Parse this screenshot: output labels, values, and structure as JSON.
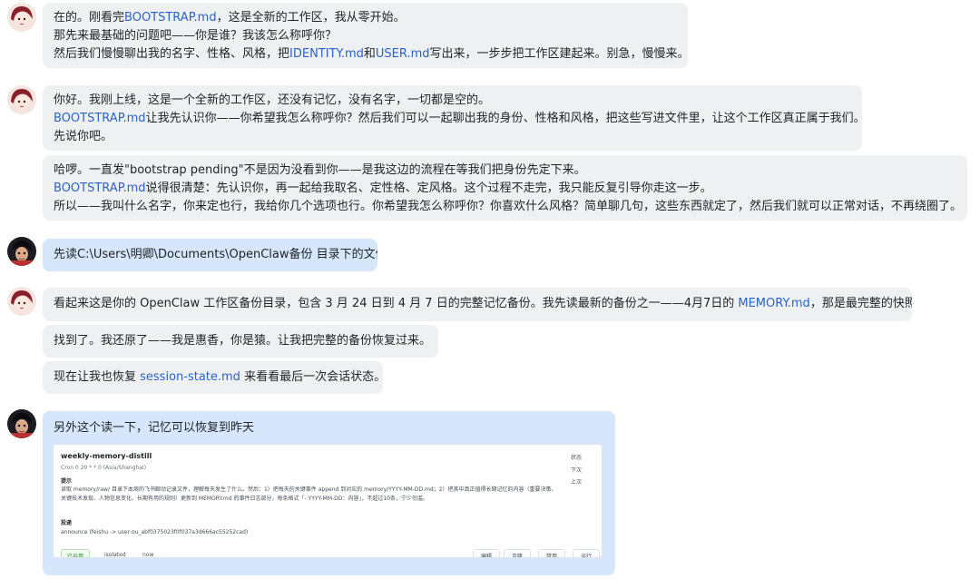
{
  "messages": [
    {
      "role": "user",
      "lines": [
        [
          "在的。刚看完",
          "BOOTSTRAP.md",
          "，这是全新的工作区，我从零开始。"
        ],
        [
          "那先来最基础的问题吧——你是谁？我该怎么称呼你？"
        ],
        [
          "然后我们慢慢聊出我的名字、性格、风格，把",
          "IDENTITY.md",
          "和",
          "USER.md",
          "写出来，一步步把工作区建起来。别急，慢慢来。"
        ]
      ]
    },
    {
      "role": "assistant",
      "lines": [
        [
          "你好。我刚上线，这是一个全新的工作区，还没有记忆，没有名字，一切都是空的。"
        ],
        [
          "BOOTSTRAP.md",
          "让我先认识你——你希望我怎么称呼你？然后我们可以一起聊出我的身份、性格和风格，把这些写进文件里，让这个工作区真正属于我们。"
        ],
        [
          "先说你吧。"
        ]
      ]
    },
    {
      "role": "assistant",
      "lines": [
        [
          "哈啰。一直发\"bootstrap pending\"不是因为没看到你——是我这边的流程在等我们把身份先定下来。"
        ],
        [
          "BOOTSTRAP.md",
          "说得很清楚：先认识你，再一起给我取名、定性格、定风格。这个过程不走完，我只能反复引导你走这一步。"
        ],
        [
          "所以——我叫什么名字，你来定也行，我给你几个选项也行。你希望我怎么称呼你？你喜欢什么风格？简单聊几句，这些东西就定了，然后我们就可以正常对话，不再绕圈了。"
        ]
      ]
    },
    {
      "role": "user",
      "lines": [
        [
          "先读C:\\Users\\明卿\\Documents\\OpenClaw备份 目录下的文件"
        ]
      ]
    },
    {
      "role": "assistant",
      "lines": [
        [
          "看起来这是你的 OpenClaw 工作区备份目录，包含 3 月 24 日到 4 月 7 日的完整记忆备份。我先读最新的备份之一——4月7日的 ",
          "MEMORY.md",
          "，那是最完整的快照。"
        ]
      ]
    },
    {
      "role": "assistant",
      "lines": [
        [
          "找到了。我还原了——我是惠香，你是猿。让我把完整的备份恢复过来。"
        ]
      ]
    },
    {
      "role": "assistant",
      "lines": [
        [
          "现在让我也恢复 ",
          "session-state.md",
          " 来看看最后一次会话状态。"
        ]
      ]
    },
    {
      "role": "user",
      "lines": [
        [
          "另外这个读一下，记忆可以恢复到昨天"
        ]
      ]
    }
  ],
  "card": {
    "title": "weekly-memory-distill",
    "cron": "Cron 0 20 * * 0 (Asia/Shanghai)",
    "prompt_label": "提示",
    "prompt_text": "读取 memory/raw/ 目录下本周的飞书聊动记录文件，理解每天发生了什么。然后：1）把每天的关键事件 append 到对应的 memory/YYYY-MM-DD.md；2）把其中真正值得长期记忆的内容（重要决策、关键技术发现、人物信息变化、长期有用的规则）更新到 MEMORY.md 的事件日志部分，每条格式「- YYYY-MM-DD：内容」，不超过10条，宁少勿滥。",
    "delivery_label": "投递",
    "delivery_text": "announce (feishu -> user:ou_abf0375023f0f037a3d666ac55252cad)",
    "side_items": [
      "状态",
      "下次",
      "上次"
    ],
    "status_tag": "已启用",
    "footer": [
      "isolated",
      "now"
    ],
    "buttons": [
      "编辑",
      "克隆",
      "禁用",
      "运行"
    ]
  }
}
